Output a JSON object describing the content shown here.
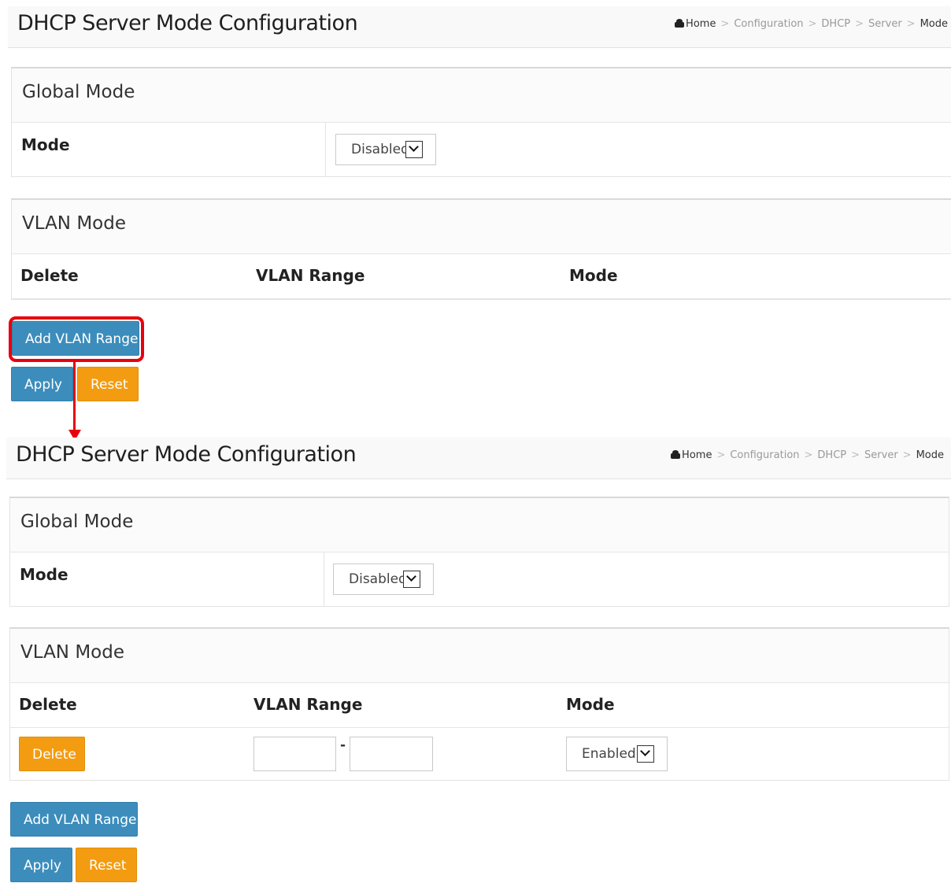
{
  "screens": [
    {
      "title": "DHCP Server Mode Configuration",
      "breadcrumb": {
        "home": "Home",
        "items": [
          "Configuration",
          "DHCP",
          "Server"
        ],
        "current": "Mode",
        "separator": ">"
      },
      "global_mode": {
        "heading": "Global Mode",
        "mode_label": "Mode",
        "mode_value": "Disabled"
      },
      "vlan_mode": {
        "heading": "VLAN Mode",
        "columns": [
          "Delete",
          "VLAN Range",
          "Mode"
        ],
        "rows": []
      },
      "buttons": {
        "add_vlan_range": "Add VLAN Range",
        "apply": "Apply",
        "reset": "Reset"
      }
    },
    {
      "title": "DHCP Server Mode Configuration",
      "breadcrumb": {
        "home": "Home",
        "items": [
          "Configuration",
          "DHCP",
          "Server"
        ],
        "current": "Mode",
        "separator": ">"
      },
      "global_mode": {
        "heading": "Global Mode",
        "mode_label": "Mode",
        "mode_value": "Disabled"
      },
      "vlan_mode": {
        "heading": "VLAN Mode",
        "columns": [
          "Delete",
          "VLAN Range",
          "Mode"
        ],
        "rows": [
          {
            "delete_label": "Delete",
            "range_start": "",
            "range_end": "",
            "range_separator": "-",
            "mode_value": "Enabled"
          }
        ]
      },
      "buttons": {
        "add_vlan_range": "Add VLAN Range",
        "apply": "Apply",
        "reset": "Reset"
      }
    }
  ],
  "annotation": {
    "highlight_color": "#e8000f"
  },
  "colors": {
    "primary_button": "#3c8dbc",
    "warning_button": "#f39c12"
  }
}
